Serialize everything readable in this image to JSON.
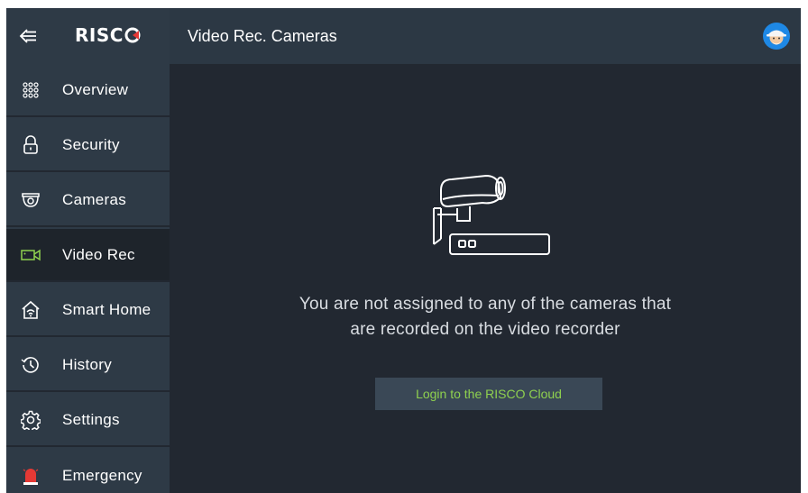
{
  "app": {
    "logo_text": "RISC"
  },
  "header": {
    "title": "Video Rec. Cameras"
  },
  "sidebar": {
    "items": [
      {
        "label": "Overview",
        "icon": "grid-dots-icon"
      },
      {
        "label": "Security",
        "icon": "lock-icon"
      },
      {
        "label": "Cameras",
        "icon": "dome-camera-icon"
      },
      {
        "label": "Video Rec",
        "icon": "video-camera-icon",
        "active": true
      },
      {
        "label": "Smart Home",
        "icon": "smart-home-icon"
      },
      {
        "label": "History",
        "icon": "history-clock-icon"
      },
      {
        "label": "Settings",
        "icon": "gear-icon"
      },
      {
        "label": "Emergency",
        "icon": "siren-icon"
      }
    ]
  },
  "main": {
    "message_line1": "You are not assigned to any of the cameras that",
    "message_line2": "are recorded on the video recorder",
    "login_button": "Login to the RISCO Cloud"
  },
  "colors": {
    "background": "#222831",
    "sidebar": "#2e3a46",
    "accent_green": "#8fd14f",
    "emergency_red": "#e53935"
  }
}
